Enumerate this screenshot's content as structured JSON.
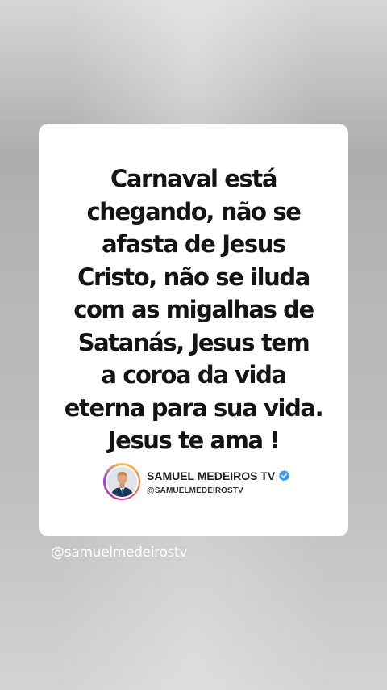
{
  "post": {
    "quote_lines": "Carnaval está\nchegando, não se\nafasta de Jesus\nCristo, não se iluda\ncom as migalhas de\nSatanás, Jesus tem\na coroa da vida\neterna para sua vida.\nJesus te ama !",
    "author": {
      "name": "SAMUEL MEDEIROS TV",
      "handle": "@SAMUELMEDEIROSTV",
      "verified": true,
      "verified_icon": "verified-badge-icon",
      "avatar_ring_colors": [
        "#f9c84a",
        "#f27a2e",
        "#d62f7b",
        "#9b3fd1"
      ]
    }
  },
  "footer": {
    "handle": "@samuelmedeirostv"
  },
  "colors": {
    "card_background": "#ffffff",
    "text_primary": "#141414",
    "verified_blue": "#3897f0",
    "background_gray": "#b8b8b8"
  }
}
